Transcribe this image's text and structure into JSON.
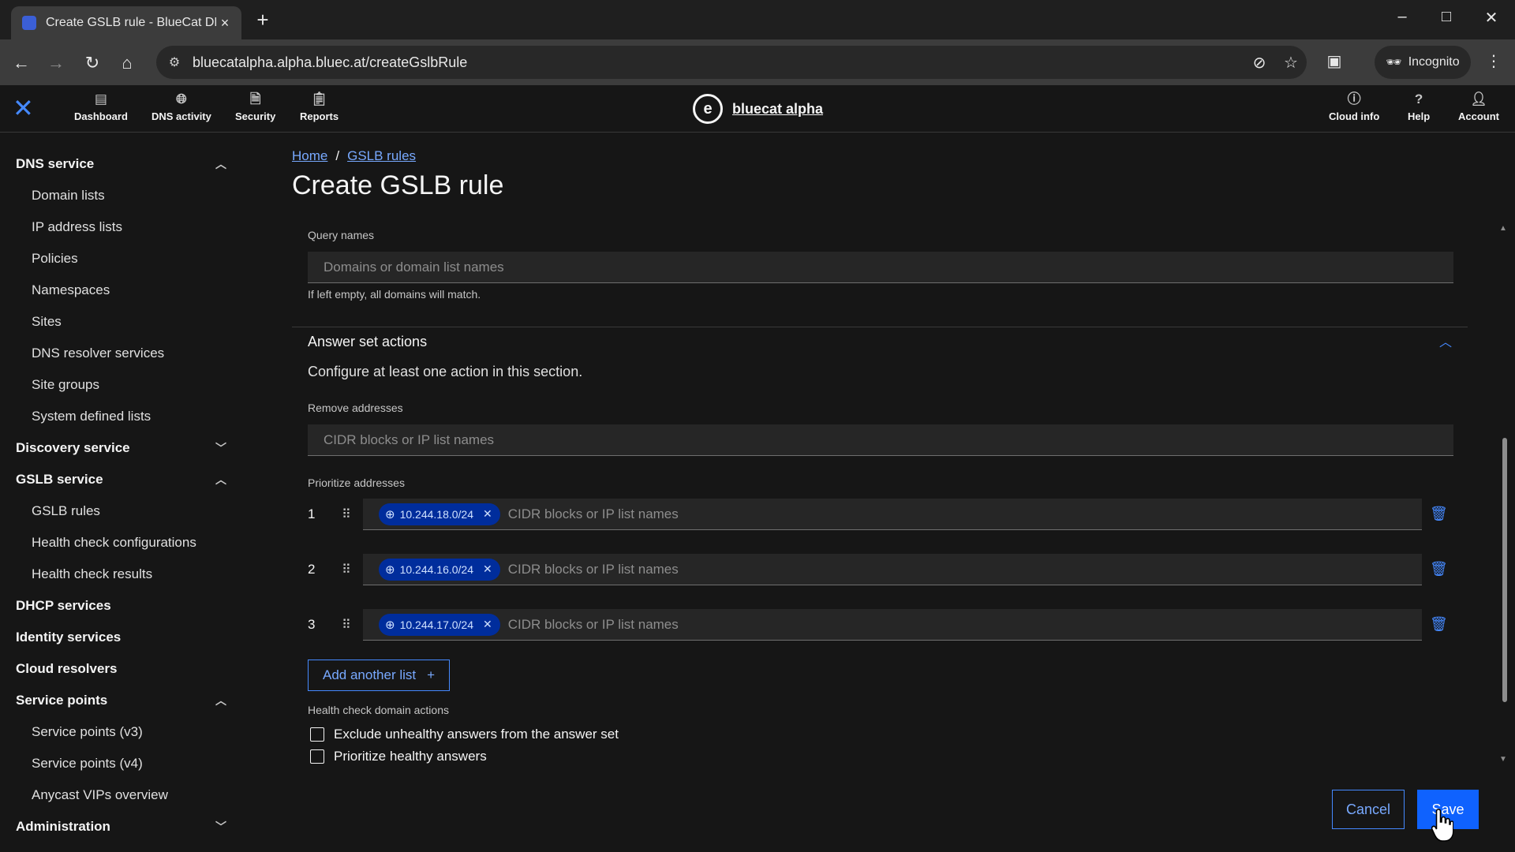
{
  "browser": {
    "tab_title": "Create GSLB rule - BlueCat DNS",
    "tab_close": "×",
    "new_tab": "+",
    "url": "bluecatalpha.alpha.bluec.at/createGslbRule",
    "incognito_label": "Incognito"
  },
  "app": {
    "close_icon": "✕",
    "nav": [
      {
        "label": "Dashboard",
        "icon": "dashboard-icon"
      },
      {
        "label": "DNS activity",
        "icon": "globe-icon"
      },
      {
        "label": "Security",
        "icon": "security-icon"
      },
      {
        "label": "Reports",
        "icon": "clipboard-icon"
      }
    ],
    "brand_logo_letter": "e",
    "brand_name": "bluecat alpha",
    "right_nav": [
      {
        "label": "Cloud info",
        "icon": "info-icon"
      },
      {
        "label": "Help",
        "icon": "help-icon"
      },
      {
        "label": "Account",
        "icon": "user-icon"
      }
    ]
  },
  "sidebar": {
    "dns_service": "DNS service",
    "dns_items": [
      "Domain lists",
      "IP address lists",
      "Policies",
      "Namespaces",
      "Sites",
      "DNS resolver services",
      "Site groups",
      "System defined lists"
    ],
    "discovery_service": "Discovery service",
    "gslb_service": "GSLB service",
    "gslb_items": [
      "GSLB rules",
      "Health check configurations",
      "Health check results"
    ],
    "dhcp_services": "DHCP services",
    "identity_services": "Identity services",
    "cloud_resolvers": "Cloud resolvers",
    "service_points": "Service points",
    "service_points_items": [
      "Service points (v3)",
      "Service points (v4)",
      "Anycast VIPs overview"
    ],
    "administration": "Administration"
  },
  "main": {
    "breadcrumb_home": "Home",
    "breadcrumb_sep": "/",
    "breadcrumb_gslb": "GSLB rules",
    "title": "Create GSLB rule",
    "query_names_label": "Query names",
    "query_names_placeholder": "Domains or domain list names",
    "query_names_helper": "If left empty, all domains will match.",
    "answer_section_title": "Answer set actions",
    "answer_section_desc": "Configure at least one action in this section.",
    "remove_label": "Remove addresses",
    "remove_placeholder": "CIDR blocks or IP list names",
    "prioritize_label": "Prioritize addresses",
    "prioritize_rows": [
      {
        "num": "1",
        "tag": "10.244.18.0/24",
        "placeholder": "CIDR blocks or IP list names"
      },
      {
        "num": "2",
        "tag": "10.244.16.0/24",
        "placeholder": "CIDR blocks or IP list names"
      },
      {
        "num": "3",
        "tag": "10.244.17.0/24",
        "placeholder": "CIDR blocks or IP list names"
      }
    ],
    "add_list_label": "Add another list",
    "health_label": "Health check domain actions",
    "checkbox_exclude": "Exclude unhealthy answers from the answer set",
    "checkbox_prioritize": "Prioritize healthy answers",
    "cancel_label": "Cancel",
    "save_label": "Save"
  }
}
